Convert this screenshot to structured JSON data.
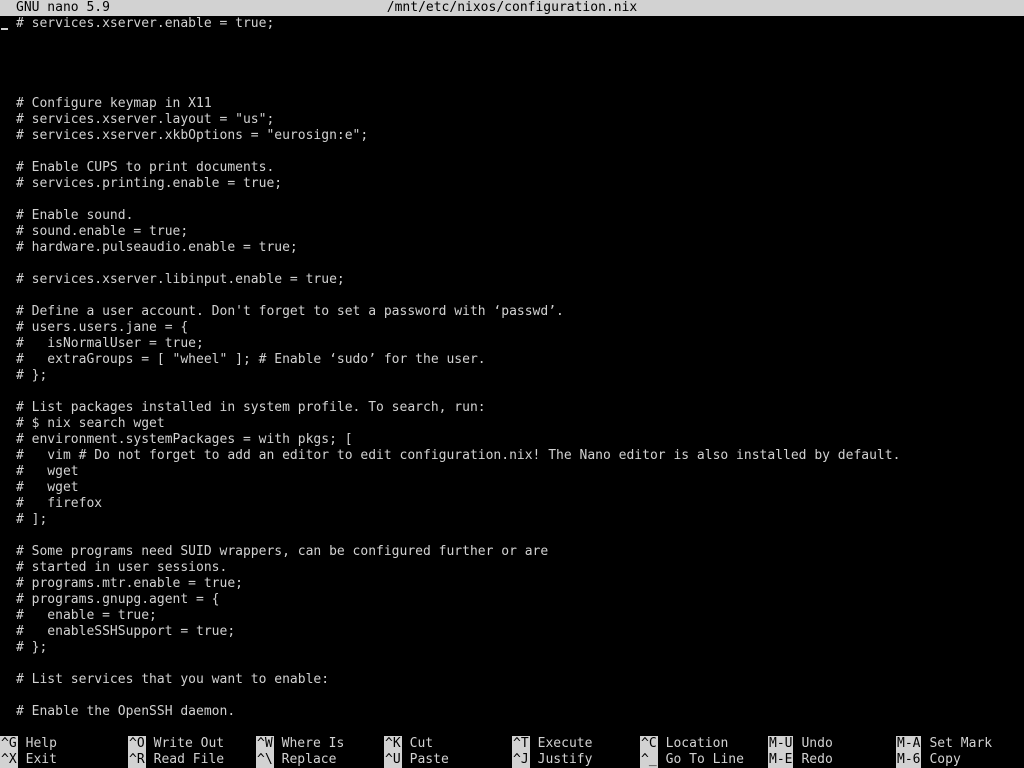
{
  "colors": {
    "background": "#000000",
    "foreground": "#d2d2d2",
    "bar_background": "#d2d2d2",
    "bar_foreground": "#000000"
  },
  "title_bar": {
    "version": "GNU nano 5.9",
    "filename": "/mnt/etc/nixos/configuration.nix"
  },
  "editor": {
    "lines": [
      "# services.xserver.enable = true;",
      "",
      "",
      "",
      "",
      "# Configure keymap in X11",
      "# services.xserver.layout = \"us\";",
      "# services.xserver.xkbOptions = \"eurosign:e\";",
      "",
      "# Enable CUPS to print documents.",
      "# services.printing.enable = true;",
      "",
      "# Enable sound.",
      "# sound.enable = true;",
      "# hardware.pulseaudio.enable = true;",
      "",
      "# services.xserver.libinput.enable = true;",
      "",
      "# Define a user account. Don't forget to set a password with ‘passwd’.",
      "# users.users.jane = {",
      "#   isNormalUser = true;",
      "#   extraGroups = [ \"wheel\" ]; # Enable ‘sudo’ for the user.",
      "# };",
      "",
      "# List packages installed in system profile. To search, run:",
      "# $ nix search wget",
      "# environment.systemPackages = with pkgs; [",
      "#   vim # Do not forget to add an editor to edit configuration.nix! The Nano editor is also installed by default.",
      "#   wget",
      "#   wget",
      "#   firefox",
      "# ];",
      "",
      "# Some programs need SUID wrappers, can be configured further or are",
      "# started in user sessions.",
      "# programs.mtr.enable = true;",
      "# programs.gnupg.agent = {",
      "#   enable = true;",
      "#   enableSSHSupport = true;",
      "# };",
      "",
      "# List services that you want to enable:",
      "",
      "# Enable the OpenSSH daemon."
    ]
  },
  "shortcuts": [
    {
      "key": "^G",
      "label": "Help"
    },
    {
      "key": "^X",
      "label": "Exit"
    },
    {
      "key": "^O",
      "label": "Write Out"
    },
    {
      "key": "^R",
      "label": "Read File"
    },
    {
      "key": "^W",
      "label": "Where Is"
    },
    {
      "key": "^\\",
      "label": "Replace"
    },
    {
      "key": "^K",
      "label": "Cut"
    },
    {
      "key": "^U",
      "label": "Paste"
    },
    {
      "key": "^T",
      "label": "Execute"
    },
    {
      "key": "^J",
      "label": "Justify"
    },
    {
      "key": "^C",
      "label": "Location"
    },
    {
      "key": "^_",
      "label": "Go To Line"
    },
    {
      "key": "M-U",
      "label": "Undo"
    },
    {
      "key": "M-E",
      "label": "Redo"
    },
    {
      "key": "M-A",
      "label": "Set Mark"
    },
    {
      "key": "M-6",
      "label": "Copy"
    }
  ]
}
